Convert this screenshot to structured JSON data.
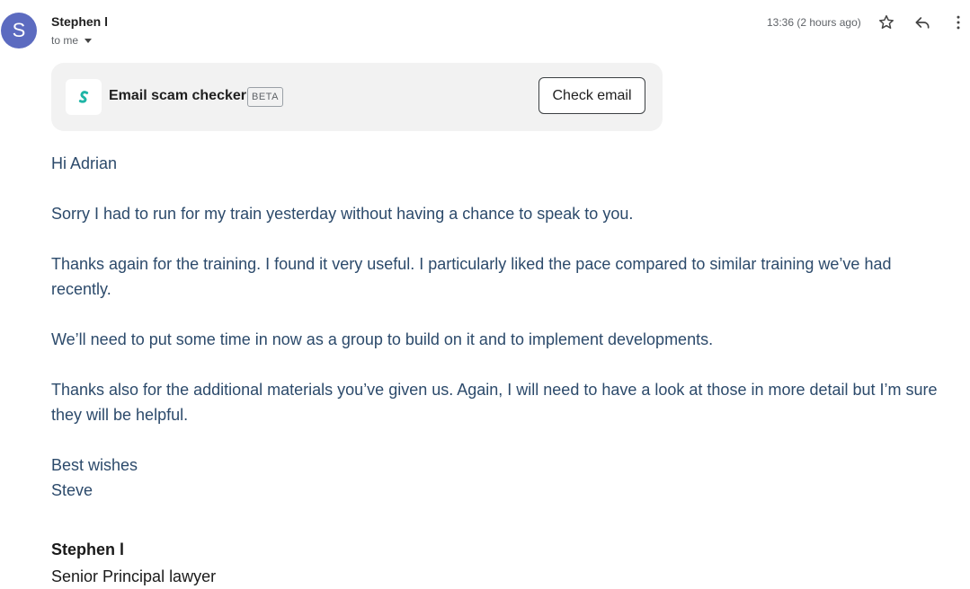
{
  "avatar_letter": "S",
  "sender": "Stephen l",
  "to_line": "to me",
  "timestamp": "13:36 (2 hours ago)",
  "icons": {
    "star": "star-icon",
    "reply": "reply-icon",
    "more": "more-vert-icon",
    "caret": "chevron-down-icon",
    "scam_logo": "surfshark-logo-icon"
  },
  "colors": {
    "avatar": "#5c6bc0",
    "body_text": "#2c4a6b",
    "scam_logo": "#1fb5a6"
  },
  "scam_checker": {
    "title": "Email scam checker",
    "badge": "BETA",
    "button": "Check email"
  },
  "body": {
    "greeting": "Hi Adrian",
    "paragraphs": [
      "Sorry I had to run for my train yesterday without having a chance to speak to you.",
      "Thanks again for the training. I found it very useful. I particularly liked the pace compared to similar training we’ve had recently.",
      "We’ll need to put some time in now as a group to build on it and to implement developments.",
      "Thanks also for the additional materials you’ve given us. Again, I will need to have a look at those in more detail but I’m sure they will be helpful."
    ],
    "sign_off": "Best wishes",
    "sign_name": "Steve"
  },
  "signature": {
    "name": "Stephen l",
    "title": "Senior Principal lawyer"
  }
}
